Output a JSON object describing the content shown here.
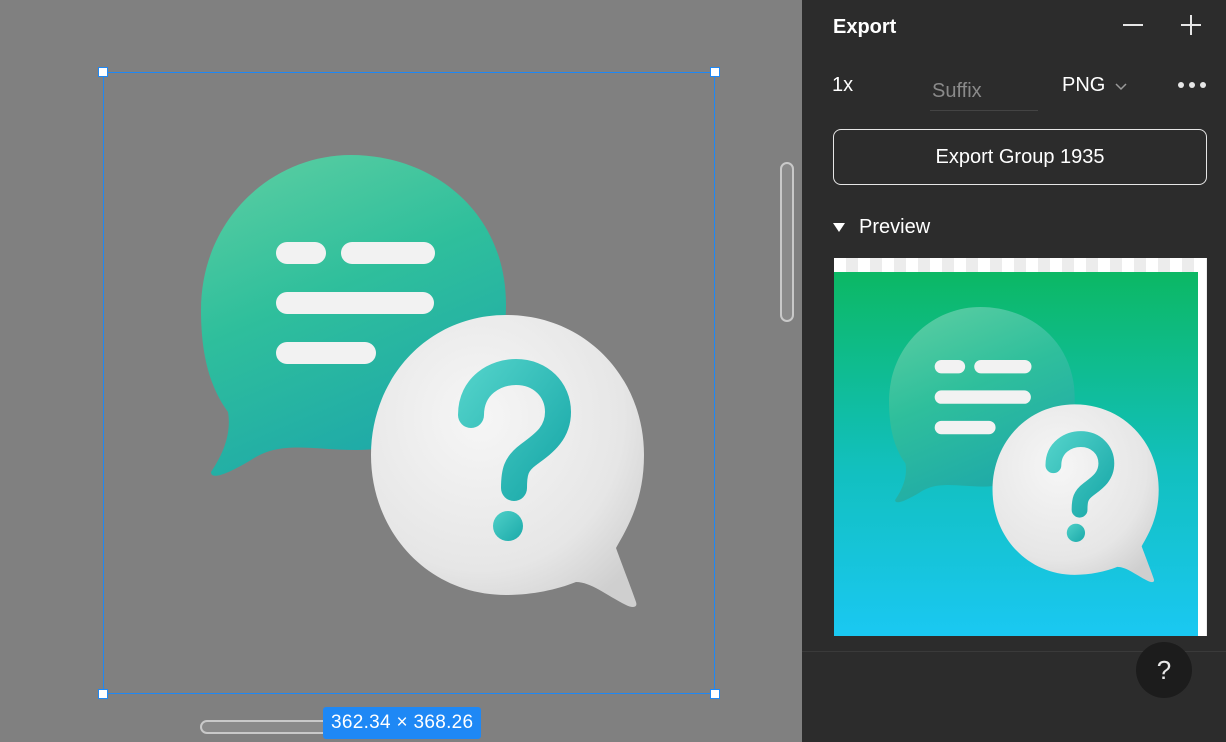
{
  "panel": {
    "title": "Export",
    "scale": "1x",
    "suffix_placeholder": "Suffix",
    "format": "PNG",
    "export_button_label": "Export Group 1935",
    "preview_label": "Preview",
    "help_label": "?"
  },
  "canvas": {
    "selection_dimensions": "362.34 × 368.26"
  },
  "colors": {
    "selection_accent": "#1e88f5",
    "panel_bg": "#2c2c2c",
    "canvas_bg": "#808080"
  }
}
